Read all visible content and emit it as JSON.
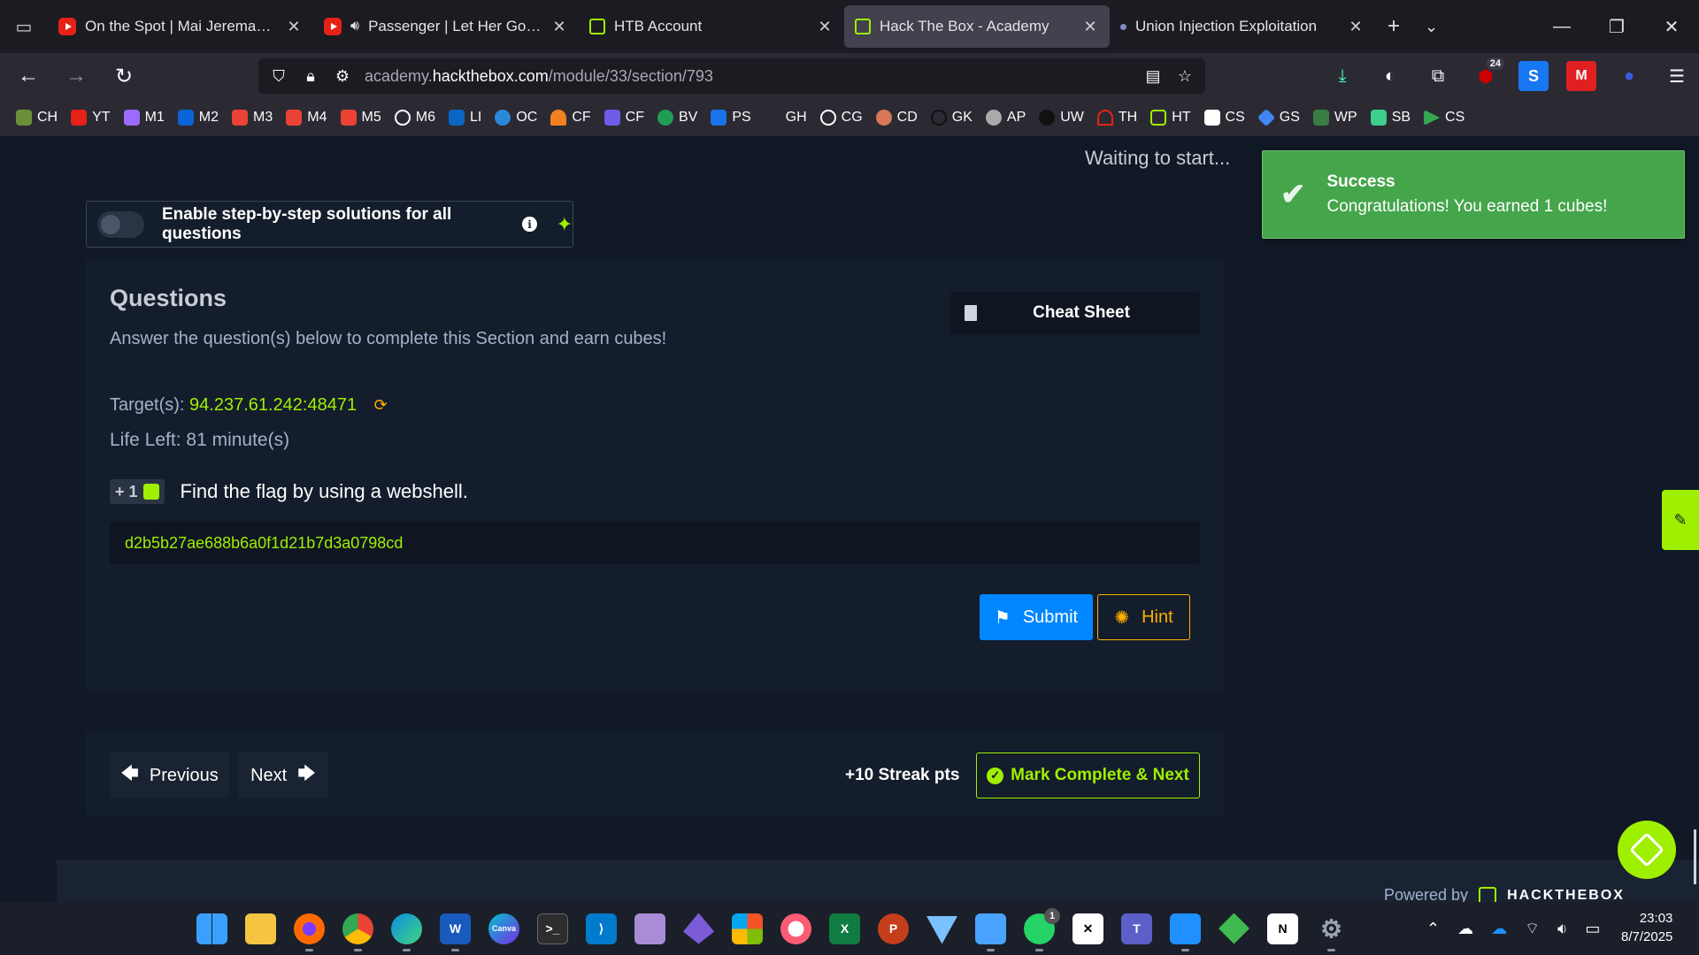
{
  "browser": {
    "tabs": [
      {
        "title": "On the Spot | Mai Jeremaya Spil",
        "favicon": "youtube-icon",
        "active": false
      },
      {
        "title": "Passenger | Let Her Go (Offi",
        "favicon": "youtube-icon",
        "audio": true,
        "active": false
      },
      {
        "title": "HTB Account",
        "favicon": "htb-icon",
        "active": false
      },
      {
        "title": "Hack The Box - Academy",
        "favicon": "htb-icon",
        "active": true
      },
      {
        "title": "Union Injection Exploitation",
        "favicon": "dot-icon",
        "active": false
      }
    ],
    "url": {
      "prefix": "academy.",
      "domain": "hackthebox.com",
      "path": "/module/33/section/793"
    },
    "extension_badge": "24",
    "bookmarks": [
      "CH",
      "YT",
      "M1",
      "M2",
      "M3",
      "M4",
      "M5",
      "M6",
      "LI",
      "OC",
      "CF",
      "CF",
      "BV",
      "PS",
      "GH",
      "CG",
      "CD",
      "GK",
      "AP",
      "UW",
      "TH",
      "HT",
      "CS",
      "GS",
      "WP",
      "SB",
      "CS"
    ]
  },
  "page": {
    "status": "Waiting to start...",
    "toggle_label": "Enable step-by-step solutions for all questions",
    "questions_title": "Questions",
    "questions_subtitle": "Answer the question(s) below to complete this Section and earn cubes!",
    "cheat_sheet": "Cheat Sheet",
    "target_label": "Target(s):",
    "target_ip": "94.237.61.242:48471",
    "life_left": "Life Left: 81 minute(s)",
    "cube_reward": "+ 1",
    "question": "Find the flag by using a webshell.",
    "answer": "d2b5b27ae688b6a0f1d21b7d3a0798cd",
    "submit": "Submit",
    "hint": "Hint",
    "previous": "Previous",
    "next": "Next",
    "streak": "+10 Streak pts",
    "mark_complete": "Mark Complete & Next",
    "powered_by": "Powered by",
    "brand": "HACKTHEBOX"
  },
  "toast": {
    "title": "Success",
    "message": "Congratulations! You earned 1 cubes!"
  },
  "taskbar": {
    "whatsapp_badge": "1",
    "time": "23:03",
    "date": "8/7/2025"
  },
  "colors": {
    "htb_green": "#9fef00",
    "primary_blue": "#0086ff",
    "hint_orange": "#ffaf00",
    "success_green": "#45a54b"
  }
}
